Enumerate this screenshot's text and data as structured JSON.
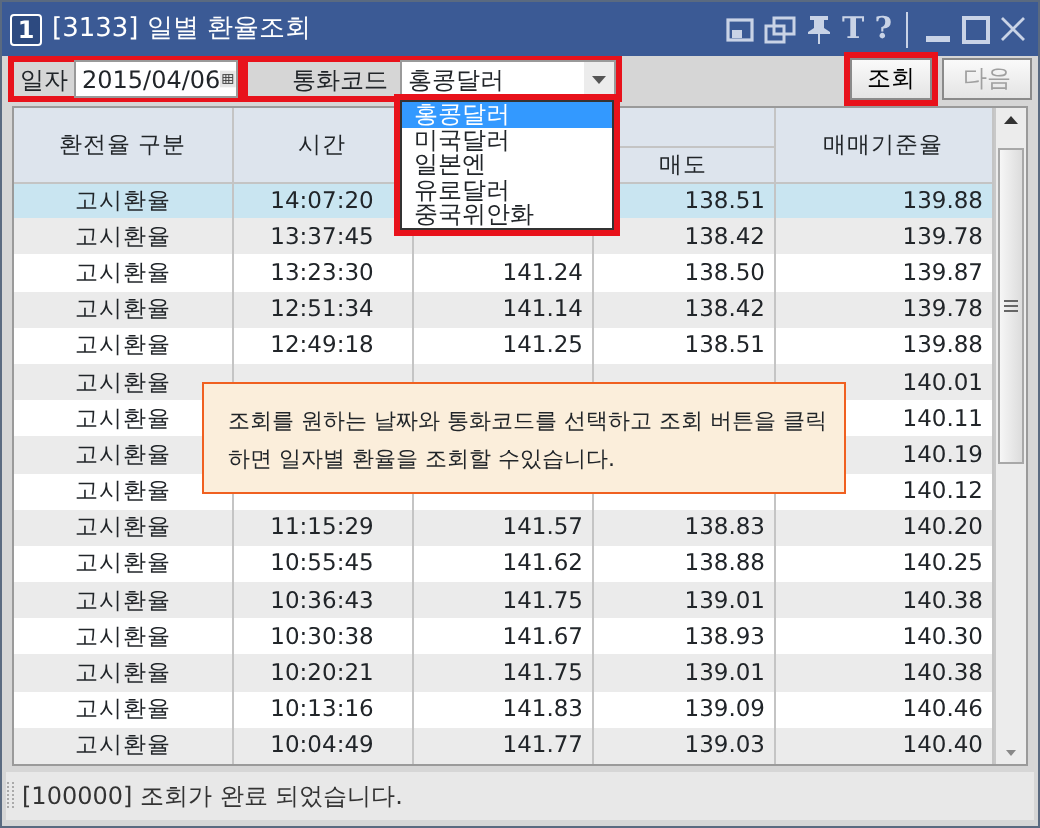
{
  "window": {
    "badge": "1",
    "title": "[3133] 일별 환율조회",
    "tool_glyphs": [
      "T",
      "?"
    ]
  },
  "toolbar": {
    "date_label": "일자",
    "date_value": "2015/04/06",
    "currency_label": "통화코드",
    "currency_value": "홍콩달러",
    "buttons": [
      {
        "label": "조회",
        "disabled": false,
        "highlighted": true
      },
      {
        "label": "다음",
        "disabled": true,
        "highlighted": false
      }
    ]
  },
  "dropdown": {
    "items": [
      {
        "label": "홍콩달러",
        "selected": true
      },
      {
        "label": "미국달러",
        "selected": false
      },
      {
        "label": "일본엔",
        "selected": false
      },
      {
        "label": "유로달러",
        "selected": false
      },
      {
        "label": "중국위안화",
        "selected": false
      }
    ]
  },
  "table": {
    "columns": [
      {
        "kind": "main",
        "label": "환전율 구분"
      },
      {
        "kind": "main",
        "label": "시간"
      },
      {
        "kind": "sub"
      },
      {
        "kind": "sub",
        "label": "매도"
      },
      {
        "kind": "main",
        "label": "매매기준율"
      }
    ],
    "rows": [
      {
        "type": "고시환율",
        "time": "14:07:20",
        "sell": "138.51",
        "base": "139.88",
        "selected": true
      },
      {
        "type": "고시환율",
        "time": "13:37:45",
        "sell": "138.42",
        "base": "139.78",
        "selected": false
      },
      {
        "type": "고시환율",
        "time": "13:23:30",
        "column_3": "141.24",
        "sell": "138.50",
        "base": "139.87",
        "selected": false
      },
      {
        "type": "고시환율",
        "time": "12:51:34",
        "column_3": "141.14",
        "sell": "138.42",
        "base": "139.78",
        "selected": false
      },
      {
        "type": "고시환율",
        "time": "12:49:18",
        "column_3": "141.25",
        "sell": "138.51",
        "base": "139.88",
        "selected": false
      },
      {
        "type": "고시환율",
        "base": "140.01",
        "selected": false
      },
      {
        "type": "고시환율",
        "base": "140.11",
        "selected": false
      },
      {
        "type": "고시환율",
        "base": "140.19",
        "selected": false
      },
      {
        "type": "고시환율",
        "base": "140.12",
        "selected": false
      },
      {
        "type": "고시환율",
        "time": "11:15:29",
        "column_3": "141.57",
        "sell": "138.83",
        "base": "140.20",
        "selected": false
      },
      {
        "type": "고시환율",
        "time": "10:55:45",
        "column_3": "141.62",
        "sell": "138.88",
        "base": "140.25",
        "selected": false
      },
      {
        "type": "고시환율",
        "time": "10:36:43",
        "column_3": "141.75",
        "sell": "139.01",
        "base": "140.38",
        "selected": false
      },
      {
        "type": "고시환율",
        "time": "10:30:38",
        "column_3": "141.67",
        "sell": "138.93",
        "base": "140.30",
        "selected": false
      },
      {
        "type": "고시환율",
        "time": "10:20:21",
        "column_3": "141.75",
        "sell": "139.01",
        "base": "140.38",
        "selected": false
      },
      {
        "type": "고시환율",
        "time": "10:13:16",
        "column_3": "141.83",
        "sell": "139.09",
        "base": "140.46",
        "selected": false
      },
      {
        "type": "고시환율",
        "time": "10:04:49",
        "column_3": "141.77",
        "sell": "139.03",
        "base": "140.40",
        "selected": false
      }
    ]
  },
  "tooltip": {
    "text": "조회를 원하는 날짜와 통화코드를 선택하고 조회 버튼을 클릭하면 일자별 환율을 조회할 수있습니다."
  },
  "status_bar": {
    "text": "[100000] 조회가 완료 되었습니다."
  }
}
